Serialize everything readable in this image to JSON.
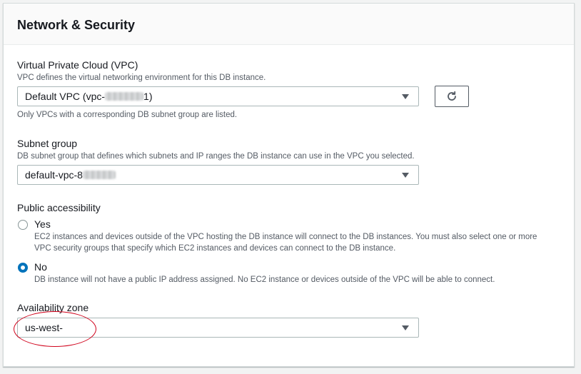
{
  "section": {
    "title": "Network & Security"
  },
  "vpc": {
    "label": "Virtual Private Cloud (VPC)",
    "description": "VPC defines the virtual networking environment for this DB instance.",
    "selected_prefix": "Default VPC (vpc-",
    "selected_suffix": "1)",
    "hint": "Only VPCs with a corresponding DB subnet group are listed.",
    "refresh_icon": "refresh-icon"
  },
  "subnet": {
    "label": "Subnet group",
    "description": "DB subnet group that defines which subnets and IP ranges the DB instance can use in the VPC you selected.",
    "selected_prefix": "default-vpc-8"
  },
  "public_access": {
    "label": "Public accessibility",
    "options": [
      {
        "label": "Yes",
        "description": "EC2 instances and devices outside of the VPC hosting the DB instance will connect to the DB instances. You must also select one or more VPC security groups that specify which EC2 instances and devices can connect to the DB instance.",
        "selected": false
      },
      {
        "label": "No",
        "description": "DB instance will not have a public IP address assigned. No EC2 instance or devices outside of the VPC will be able to connect.",
        "selected": true
      }
    ]
  },
  "availability": {
    "label": "Availability zone",
    "selected": "us-west-"
  },
  "colors": {
    "accent": "#0073bb",
    "annotation": "#d0021b"
  }
}
